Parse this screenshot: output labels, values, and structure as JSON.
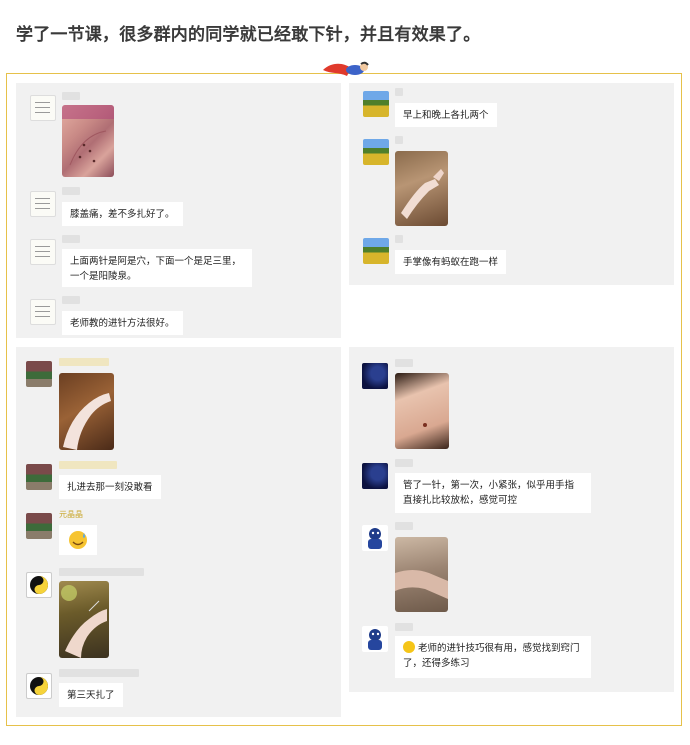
{
  "headline": "学了一节课，很多群内的同学就已经敢下针，并且有效果了。",
  "panels": {
    "top_left": {
      "messages": [
        {
          "type": "image",
          "depicts": "knee-photo"
        },
        {
          "type": "text",
          "text": "膝盖痛，差不多扎好了。"
        },
        {
          "type": "text",
          "text": "上面两针是阿是穴，下面一个是足三里，一个是阳陵泉。"
        },
        {
          "type": "text",
          "text": "老师教的进针方法很好。"
        }
      ]
    },
    "top_right": {
      "messages": [
        {
          "type": "text",
          "text": "早上和晚上各扎两个"
        },
        {
          "type": "image",
          "depicts": "arm-photo"
        },
        {
          "type": "text",
          "text": "手掌像有蚂蚁在跑一样"
        }
      ]
    },
    "bottom_left": {
      "messages": [
        {
          "type": "image",
          "depicts": "leg-photo"
        },
        {
          "type": "text",
          "text": "扎进去那一刻没敢看"
        },
        {
          "type": "sender",
          "text": "元晶晶"
        },
        {
          "type": "emoji",
          "depicts": "sweat-smile-emoji"
        },
        {
          "type": "image",
          "depicts": "leg-needle-photo"
        },
        {
          "type": "text",
          "text": "第三天扎了"
        }
      ]
    },
    "bottom_right": {
      "messages": [
        {
          "type": "image",
          "depicts": "skin-photo"
        },
        {
          "type": "text",
          "text": "管了一针，第一次，小紧张，似乎用手指直接扎比较放松，感觉可控"
        },
        {
          "type": "image",
          "depicts": "forearm-photo"
        },
        {
          "type": "text",
          "text": "老师的进针技巧很有用，感觉找到窍门了，还得多练习"
        }
      ]
    }
  },
  "colors": {
    "frame_border": "#e6c14a",
    "panel_bg": "#f1f1f1",
    "bubble_bg": "#ffffff"
  }
}
